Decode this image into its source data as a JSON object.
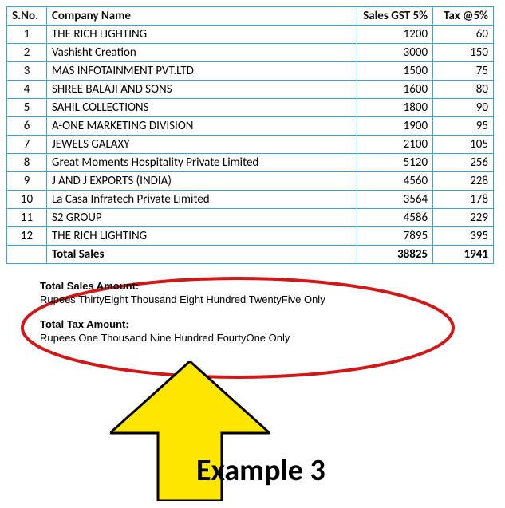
{
  "table": {
    "headers": {
      "sno": "S.No.",
      "company": "Company Name",
      "sales": "Sales GST 5%",
      "tax": "Tax @5%"
    },
    "rows": [
      {
        "sno": "1",
        "company": "THE RICH LIGHTING",
        "sales": "1200",
        "tax": "60"
      },
      {
        "sno": "2",
        "company": "Vashisht Creation",
        "sales": "3000",
        "tax": "150"
      },
      {
        "sno": "3",
        "company": "MAS INFOTAINMENT PVT.LTD",
        "sales": "1500",
        "tax": "75"
      },
      {
        "sno": "4",
        "company": "SHREE BALAJI AND SONS",
        "sales": "1600",
        "tax": "80"
      },
      {
        "sno": "5",
        "company": "SAHIL COLLECTIONS",
        "sales": "1800",
        "tax": "90"
      },
      {
        "sno": "6",
        "company": "A-ONE MARKETING DIVISION",
        "sales": "1900",
        "tax": "95"
      },
      {
        "sno": "7",
        "company": "JEWELS GALAXY",
        "sales": "2100",
        "tax": "105"
      },
      {
        "sno": "8",
        "company": "Great Moments Hospitality Private Limited",
        "sales": "5120",
        "tax": "256"
      },
      {
        "sno": "9",
        "company": "J AND J EXPORTS (INDIA)",
        "sales": "4560",
        "tax": "228"
      },
      {
        "sno": "10",
        "company": "La Casa Infratech Private Limited",
        "sales": "3564",
        "tax": "178"
      },
      {
        "sno": "11",
        "company": "S2 GROUP",
        "sales": "4586",
        "tax": "229"
      },
      {
        "sno": "12",
        "company": "THE RICH LIGHTING",
        "sales": "7895",
        "tax": "395"
      }
    ],
    "total": {
      "label": "Total Sales",
      "sales": "38825",
      "tax": "1941"
    }
  },
  "amounts": {
    "sales_label": "Total Sales Amount:",
    "sales_words": "Rupees ThirtyEight Thousand Eight Hundred TwentyFive Only",
    "tax_label": "Total Tax Amount:",
    "tax_words": "Rupees One Thousand Nine Hundred FourtyOne Only"
  },
  "annotation": {
    "example_label": "Example 3"
  },
  "colors": {
    "border": "#33aacc",
    "ellipse": "#d01818",
    "arrow_fill": "#ffe600",
    "arrow_stroke": "#000000"
  },
  "chart_data": {
    "type": "table",
    "title": "Sales GST 5% and Tax @5% by Company",
    "columns": [
      "S.No.",
      "Company Name",
      "Sales GST 5%",
      "Tax @5%"
    ],
    "rows": [
      [
        1,
        "THE RICH LIGHTING",
        1200,
        60
      ],
      [
        2,
        "Vashisht Creation",
        3000,
        150
      ],
      [
        3,
        "MAS INFOTAINMENT PVT.LTD",
        1500,
        75
      ],
      [
        4,
        "SHREE BALAJI AND SONS",
        1600,
        80
      ],
      [
        5,
        "SAHIL COLLECTIONS",
        1800,
        90
      ],
      [
        6,
        "A-ONE MARKETING DIVISION",
        1900,
        95
      ],
      [
        7,
        "JEWELS GALAXY",
        2100,
        105
      ],
      [
        8,
        "Great Moments Hospitality Private Limited",
        5120,
        256
      ],
      [
        9,
        "J AND J EXPORTS (INDIA)",
        4560,
        228
      ],
      [
        10,
        "La Casa Infratech Private Limited",
        3564,
        178
      ],
      [
        11,
        "S2 GROUP",
        4586,
        229
      ],
      [
        12,
        "THE RICH LIGHTING",
        7895,
        395
      ]
    ],
    "totals": {
      "label": "Total Sales",
      "sales": 38825,
      "tax": 1941
    }
  }
}
